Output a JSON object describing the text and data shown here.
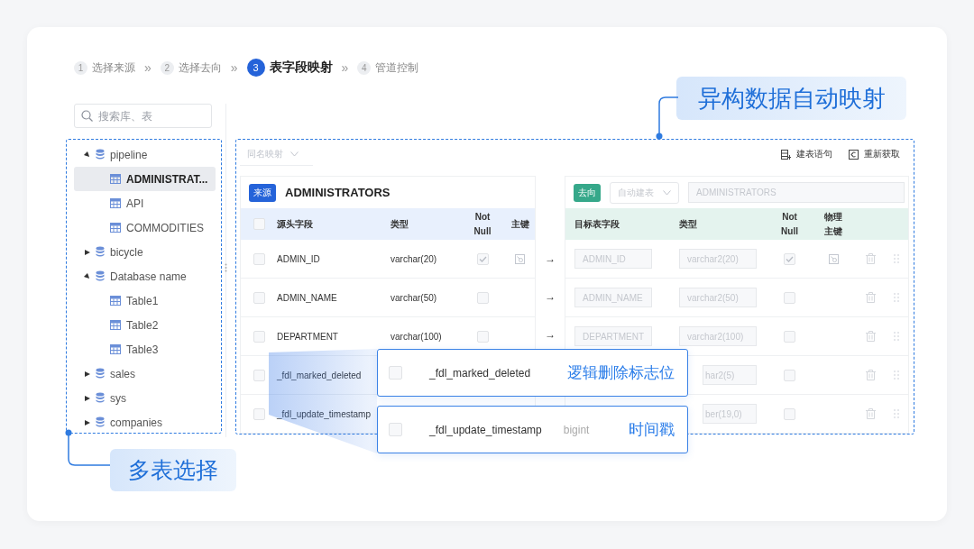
{
  "steps": [
    {
      "number": "1",
      "label": "选择来源",
      "selected": false
    },
    {
      "number": "2",
      "label": "选择去向",
      "selected": false
    },
    {
      "number": "3",
      "label": "表字段映射",
      "selected": true
    },
    {
      "number": "4",
      "label": "管道控制",
      "selected": false
    }
  ],
  "step_separator": "»",
  "search": {
    "placeholder": "搜索库、表"
  },
  "tree": [
    {
      "label": "pipeline",
      "expanded": true,
      "selected": false,
      "children": [
        {
          "label": "ADMINISTRAT...",
          "selected": true
        },
        {
          "label": "API",
          "selected": false
        },
        {
          "label": "COMMODITIES",
          "selected": false
        }
      ]
    },
    {
      "label": "bicycle",
      "expanded": false,
      "selected": false
    },
    {
      "label": "Database name",
      "expanded": true,
      "selected": false,
      "children": [
        {
          "label": "Table1",
          "selected": false
        },
        {
          "label": "Table2",
          "selected": false
        },
        {
          "label": "Table3",
          "selected": false
        }
      ]
    },
    {
      "label": "sales",
      "expanded": false,
      "selected": false
    },
    {
      "label": "sys",
      "expanded": false,
      "selected": false
    },
    {
      "label": "companies",
      "expanded": false,
      "selected": false
    }
  ],
  "mapping_mode": {
    "value": "同名映射"
  },
  "toolbar": [
    {
      "label": "建表语句",
      "kind": "ddl"
    },
    {
      "label": "重新获取",
      "kind": "refresh"
    }
  ],
  "source": {
    "badge": "来源",
    "table": "ADMINISTRATORS",
    "select_all": {
      "checked": false
    },
    "columns": [
      "源头字段",
      "类型",
      "Not Null",
      "主键"
    ],
    "rows": [
      {
        "selected": false,
        "field": "ADMIN_ID",
        "type": "varchar(20)",
        "not_null": true,
        "primary_key": true,
        "arrow": "→"
      },
      {
        "selected": false,
        "field": "ADMIN_NAME",
        "type": "varchar(50)",
        "not_null": false,
        "primary_key": false,
        "arrow": "→"
      },
      {
        "selected": false,
        "field": "DEPARTMENT",
        "type": "varchar(100)",
        "not_null": false,
        "primary_key": false,
        "arrow": "→"
      },
      {
        "selected": false,
        "field": "_fdl_marked_deleted"
      },
      {
        "selected": false,
        "field": "_fdl_update_timestamp"
      }
    ]
  },
  "target": {
    "badge": "去向",
    "create_mode": "自动建表",
    "table": "ADMINISTRATORS",
    "columns": [
      "目标表字段",
      "类型",
      "Not Null",
      "物理主键"
    ],
    "rows": [
      {
        "field": "ADMIN_ID",
        "type": "varchar2(20)",
        "not_null": true,
        "primary_key": true
      },
      {
        "field": "ADMIN_NAME",
        "type": "varchar2(50)",
        "not_null": false,
        "primary_key": false
      },
      {
        "field": "DEPARTMENT",
        "type": "varchar2(100)",
        "not_null": false,
        "primary_key": false
      },
      {
        "type": "har2(5)",
        "not_null": false,
        "primary_key": false
      },
      {
        "type": "ber(19,0)",
        "not_null": false,
        "primary_key": false
      }
    ]
  },
  "popups": [
    {
      "selected": false,
      "field": "_fdl_marked_deleted",
      "note": "逻辑删除标志位"
    },
    {
      "selected": false,
      "field": "_fdl_update_timestamp",
      "type": "bigint",
      "note": "时间戳"
    }
  ],
  "callouts": [
    {
      "text": "异构数据自动映射",
      "kind": "top"
    },
    {
      "text": "多表选择",
      "kind": "bottom"
    }
  ]
}
